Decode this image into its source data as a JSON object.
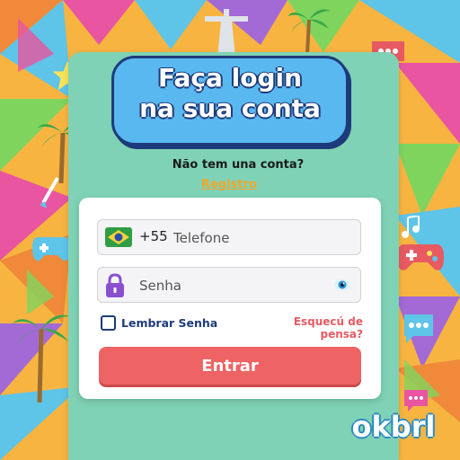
{
  "header": {
    "title": "Faça login\nna sua conta"
  },
  "signup": {
    "prompt": "Não tem una conta?",
    "link_label": "Registro"
  },
  "phone": {
    "country_code": "+55",
    "placeholder": "Telefone",
    "value": ""
  },
  "password": {
    "placeholder": "Senha",
    "value": ""
  },
  "remember": {
    "label": "Lembrar Senha",
    "checked": false
  },
  "forgot": {
    "label": "Esquecú de pensa?"
  },
  "submit": {
    "label": "Entrar"
  },
  "brand": {
    "name": "okbrl"
  },
  "colors": {
    "panel": "#7fd2b5",
    "bubble": "#5ab8f0",
    "submit": "#ee6363",
    "link": "#f2a72b",
    "forgot": "#e85a62"
  },
  "icons": [
    "brazil-flag-icon",
    "lock-icon",
    "eye-icon",
    "palm-tree-icon",
    "chat-bubble-icon",
    "gamepad-icon",
    "music-note-icon",
    "star-icon",
    "christ-statue-icon"
  ]
}
